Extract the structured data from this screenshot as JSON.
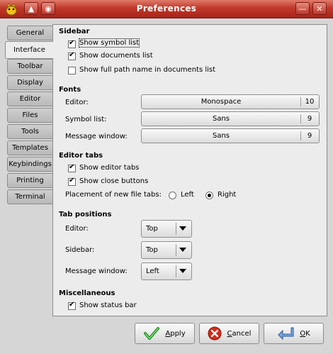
{
  "window": {
    "title": "Preferences",
    "minimize_glyph": "—",
    "maximize_glyph": "◻",
    "close_glyph": "✕"
  },
  "tabs": [
    {
      "label": "General",
      "active": false
    },
    {
      "label": "Interface",
      "active": true
    },
    {
      "label": "Toolbar",
      "active": false
    },
    {
      "label": "Display",
      "active": false
    },
    {
      "label": "Editor",
      "active": false
    },
    {
      "label": "Files",
      "active": false
    },
    {
      "label": "Tools",
      "active": false
    },
    {
      "label": "Templates",
      "active": false
    },
    {
      "label": "Keybindings",
      "active": false
    },
    {
      "label": "Printing",
      "active": false
    },
    {
      "label": "Terminal",
      "active": false
    }
  ],
  "sidebar": {
    "title": "Sidebar",
    "show_symbol_list": {
      "label": "Show symbol list",
      "checked": true
    },
    "show_documents_list": {
      "label": "Show documents list",
      "checked": true
    },
    "show_full_path": {
      "label": "Show full path name in documents list",
      "checked": false
    }
  },
  "fonts": {
    "title": "Fonts",
    "editor": {
      "label": "Editor:",
      "font": "Monospace",
      "size": "10"
    },
    "symbol_list": {
      "label": "Symbol list:",
      "font": "Sans",
      "size": "9"
    },
    "message_window": {
      "label": "Message window:",
      "font": "Sans",
      "size": "9"
    }
  },
  "editor_tabs": {
    "title": "Editor tabs",
    "show_editor_tabs": {
      "label": "Show editor tabs",
      "checked": true
    },
    "show_close_buttons": {
      "label": "Show close buttons",
      "checked": true
    },
    "placement_label": "Placement of new file tabs:",
    "left_label": "Left",
    "right_label": "Right",
    "placement": "Right"
  },
  "tab_positions": {
    "title": "Tab positions",
    "editor": {
      "label": "Editor:",
      "value": "Top"
    },
    "sidebar": {
      "label": "Sidebar:",
      "value": "Top"
    },
    "message_window": {
      "label": "Message window:",
      "value": "Left"
    }
  },
  "misc": {
    "title": "Miscellaneous",
    "show_status_bar": {
      "label": "Show status bar",
      "checked": true
    }
  },
  "buttons": {
    "apply": {
      "mnemonic": "A",
      "rest": "pply"
    },
    "cancel": {
      "mnemonic": "C",
      "rest": "ancel"
    },
    "ok": {
      "mnemonic": "O",
      "rest": "K"
    }
  },
  "colors": {
    "titlebar": "#c0382a",
    "background": "#d6d6d6",
    "panel": "#ececec"
  }
}
